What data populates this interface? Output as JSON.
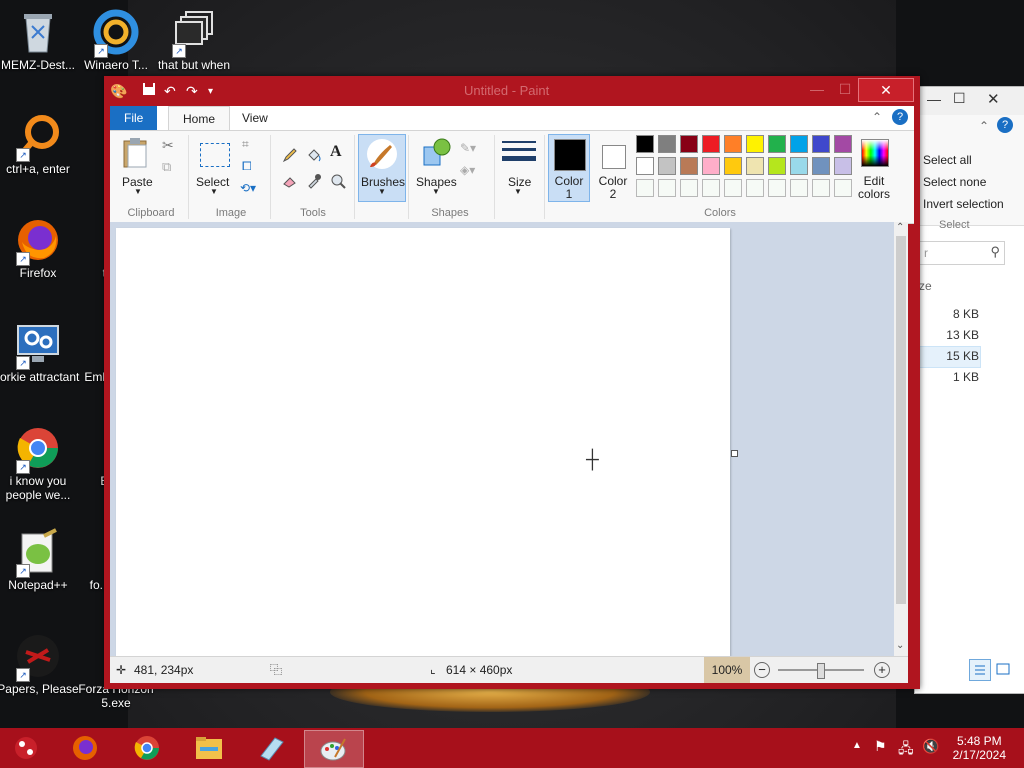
{
  "desktop": {
    "icons": [
      {
        "label": "MEMZ-Dest..."
      },
      {
        "label": "Winaero T..."
      },
      {
        "label": "that but when"
      },
      {
        "label": "ctrl+a, enter"
      },
      {
        "label": "Firefox"
      },
      {
        "label": "the..."
      },
      {
        "label": "forkie attractant"
      },
      {
        "label": "Emb... Do..."
      },
      {
        "label": "i know you people we..."
      },
      {
        "label": "End..."
      },
      {
        "label": "Notepad++"
      },
      {
        "label": "fo... son..."
      },
      {
        "label": "Papers, Please"
      },
      {
        "label": "Forza Horizon 5.exe"
      }
    ]
  },
  "explorer": {
    "select_all": "Select all",
    "select_none": "Select none",
    "invert_selection": "Invert selection",
    "group_label": "Select",
    "search_placeholder": "r",
    "col_size": "ze",
    "sizes": [
      "8 KB",
      "13 KB",
      "15 KB",
      "1 KB"
    ]
  },
  "paint": {
    "title": "Untitled - Paint",
    "tabs": {
      "file": "File",
      "home": "Home",
      "view": "View"
    },
    "ribbon": {
      "paste": "Paste",
      "select": "Select",
      "brushes": "Brushes",
      "shapes": "Shapes",
      "size": "Size",
      "color1": "Color 1",
      "color2": "Color 2",
      "edit_colors": "Edit colors",
      "groups": {
        "clipboard": "Clipboard",
        "image": "Image",
        "tools": "Tools",
        "shapes": "Shapes",
        "colors": "Colors"
      }
    },
    "palette_row1": [
      "#000000",
      "#7f7f7f",
      "#880015",
      "#ed1c24",
      "#ff7f27",
      "#fff200",
      "#22b14c",
      "#00a2e8",
      "#3f48cc",
      "#a349a4"
    ],
    "palette_row2": [
      "#ffffff",
      "#c3c3c3",
      "#b97a57",
      "#ffaec9",
      "#ffc90e",
      "#efe4b0",
      "#b5e61d",
      "#99d9ea",
      "#7092be",
      "#c8bfe7"
    ],
    "status": {
      "cursor_pos": "481, 234px",
      "canvas_size": "614 × 460px",
      "zoom": "100%"
    }
  },
  "taskbar": {
    "time": "5:48 PM",
    "date": "2/17/2024"
  }
}
